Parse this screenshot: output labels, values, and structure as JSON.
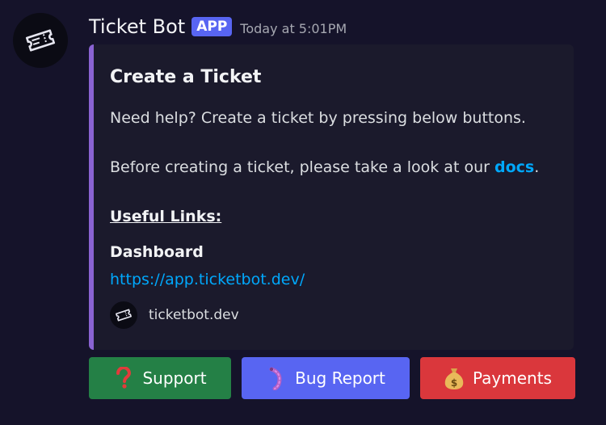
{
  "message": {
    "username": "Ticket Bot",
    "badge": "APP",
    "timestamp": "Today at 5:01PM"
  },
  "embed": {
    "title": "Create a Ticket",
    "description_line1": "Need help? Create a ticket by pressing below buttons.",
    "description_line2_prefix": "Before creating a ticket, please take a look at our ",
    "docs_link": "docs",
    "description_line2_suffix": ".",
    "useful_links_heading": "Useful Links:",
    "field_name": "Dashboard",
    "field_value": "https://app.ticketbot.dev/",
    "footer_text": "ticketbot.dev",
    "accent_color": "#8a63d2"
  },
  "buttons": [
    {
      "label": "Support",
      "icon": "question-mark-icon",
      "color": "#248046"
    },
    {
      "label": "Bug Report",
      "icon": "bug-icon",
      "color": "#5865f2"
    },
    {
      "label": "Payments",
      "icon": "money-bag-icon",
      "color": "#da373c"
    }
  ]
}
